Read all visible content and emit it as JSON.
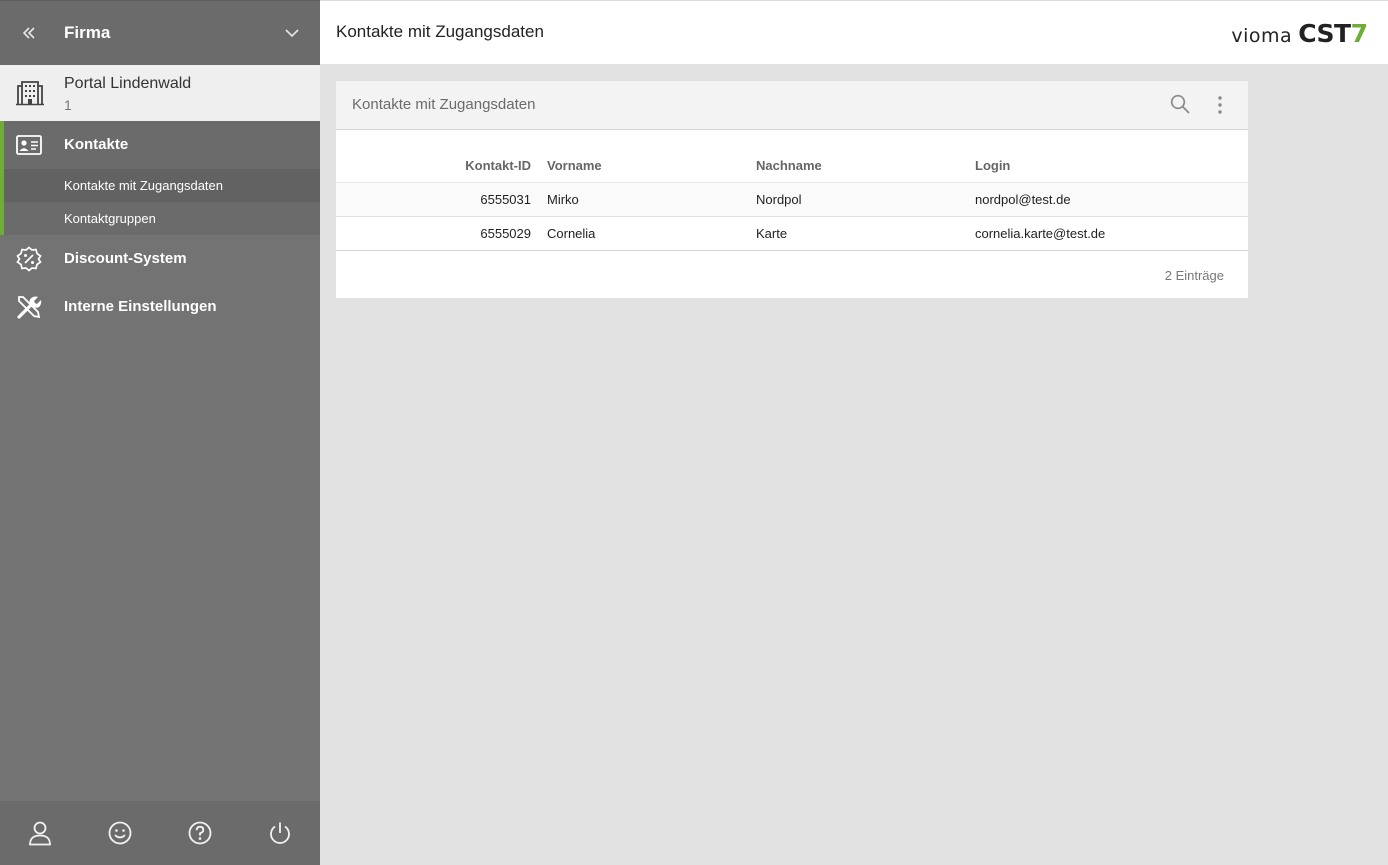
{
  "sidebar": {
    "title": "Firma",
    "portal": {
      "name": "Portal Lindenwald",
      "number": "1"
    },
    "kontakte_label": "Kontakte",
    "sub_items": [
      {
        "label": "Kontakte mit Zugangsdaten",
        "active": true
      },
      {
        "label": "Kontaktgruppen",
        "active": false
      }
    ],
    "discount_label": "Discount-System",
    "settings_label": "Interne Einstellungen",
    "footer_icons": [
      "user-icon",
      "smiley-icon",
      "help-icon",
      "power-icon"
    ]
  },
  "topbar": {
    "title": "Kontakte mit Zugangsdaten",
    "brand": {
      "vioma": "vioma",
      "cst": "CST",
      "seven": "7"
    }
  },
  "card": {
    "title": "Kontakte mit Zugangsdaten",
    "columns": [
      "Kontakt-ID",
      "Vorname",
      "Nachname",
      "Login"
    ],
    "rows": [
      [
        "6555031",
        "Mirko",
        "Nordpol",
        "nordpol@test.de"
      ],
      [
        "6555029",
        "Cornelia",
        "Karte",
        "cornelia.karte@test.de"
      ]
    ],
    "count": "2 Einträge"
  },
  "colors": {
    "accent": "#6fac3a",
    "sidebar": "#737373",
    "background": "#e1e1e1"
  }
}
